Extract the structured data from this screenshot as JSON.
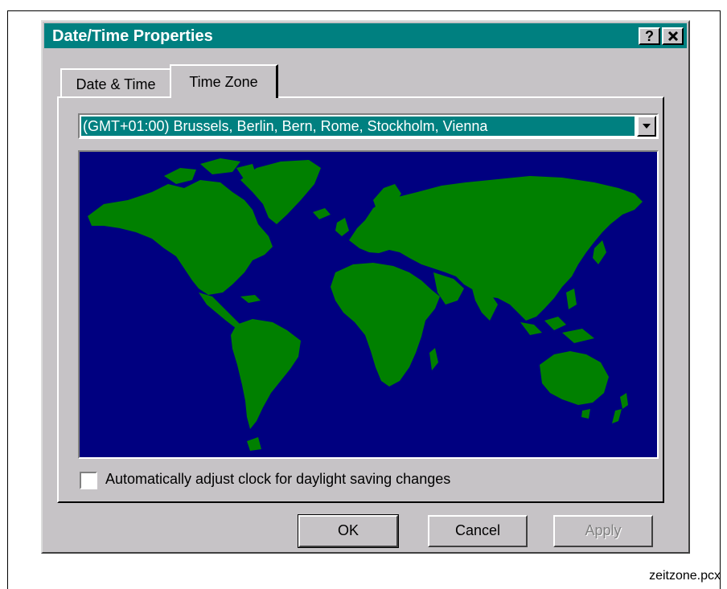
{
  "dialog": {
    "title": "Date/Time Properties",
    "help_label": "?",
    "close_label": "✕"
  },
  "tabs": [
    {
      "label": "Date & Time",
      "active": false
    },
    {
      "label": "Time Zone",
      "active": true
    }
  ],
  "timezone": {
    "selected": "(GMT+01:00) Brussels, Berlin, Bern, Rome, Stockholm, Vienna"
  },
  "map": {
    "ocean_color": "#000080",
    "land_color": "#008000"
  },
  "checkbox": {
    "label": "Automatically adjust clock for daylight saving changes",
    "checked": false
  },
  "buttons": {
    "ok": "OK",
    "cancel": "Cancel",
    "apply": "Apply"
  },
  "caption": "zeitzone.pcx",
  "colors": {
    "titlebar": "#008080",
    "face": "#c6c3c6",
    "selection": "#008080"
  }
}
